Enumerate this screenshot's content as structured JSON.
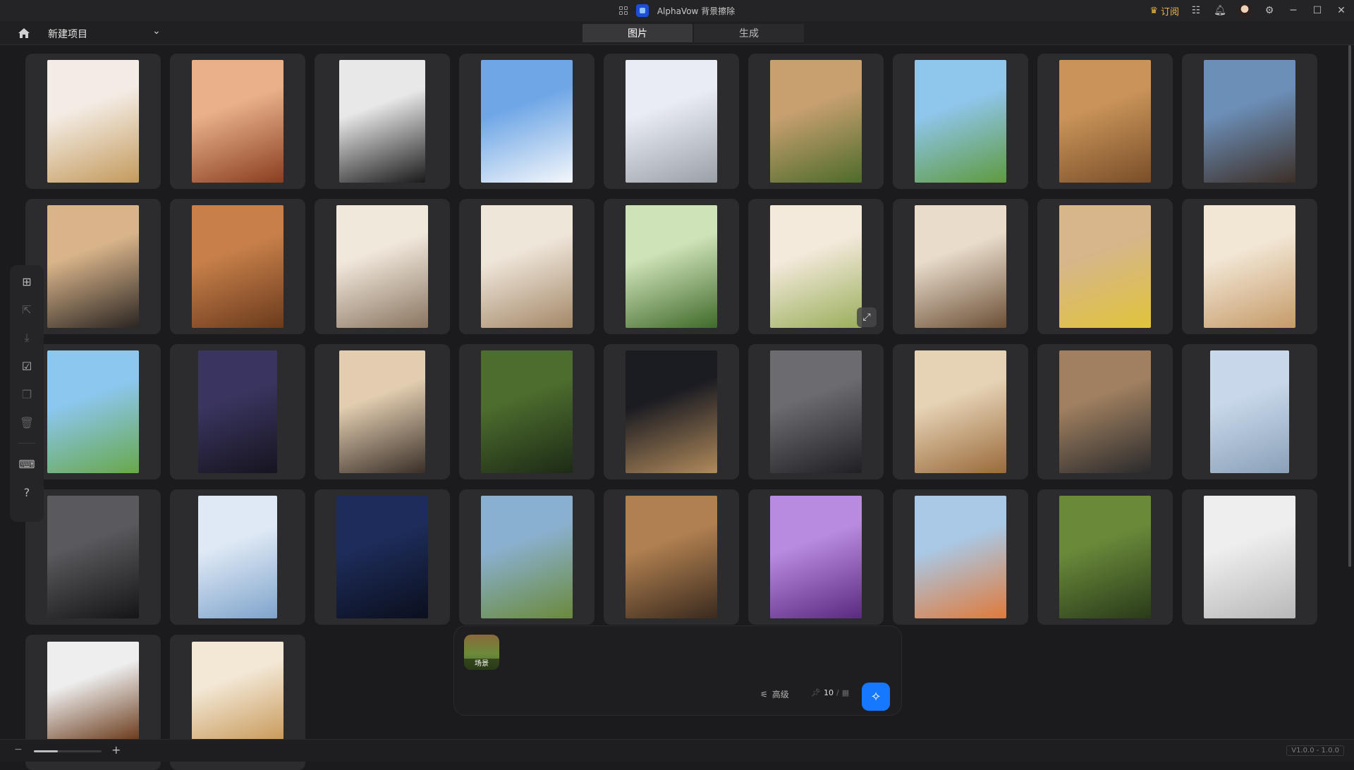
{
  "window": {
    "title": "AlphaVow 背景擦除",
    "subscribe_label": "订阅"
  },
  "toolbar": {
    "project_name": "新建项目"
  },
  "tabs": [
    {
      "label": "图片",
      "active": true
    },
    {
      "label": "生成",
      "active": false
    }
  ],
  "gallery": {
    "items": [
      {
        "name": "perfume-swirl",
        "c1": "#f3ece4",
        "c2": "#c49a5c"
      },
      {
        "name": "perfume-roses",
        "c1": "#e8b18a",
        "c2": "#8a3d20"
      },
      {
        "name": "serum-black-white",
        "c1": "#e8e8e8",
        "c2": "#1a1a1a"
      },
      {
        "name": "cream-jar-blue",
        "c1": "#6fa7e6",
        "c2": "#f4f7fb"
      },
      {
        "name": "perfume-silver",
        "c1": "#e9edf3",
        "c2": "#9aa0a8"
      },
      {
        "name": "speaker-tent",
        "c1": "#c8a070",
        "c2": "#4d6b2a"
      },
      {
        "name": "phone-meadow",
        "c1": "#8fc6ec",
        "c2": "#5f9a3e"
      },
      {
        "name": "phone-desert",
        "c1": "#c9945a",
        "c2": "#7a4e28"
      },
      {
        "name": "smartwatch-rock",
        "c1": "#6c8fb8",
        "c2": "#3d2f27"
      },
      {
        "name": "camera-table",
        "c1": "#d9b48a",
        "c2": "#2a2522"
      },
      {
        "name": "phone-armchair",
        "c1": "#c8804a",
        "c2": "#6a3a1c"
      },
      {
        "name": "fan-room",
        "c1": "#f1e8dc",
        "c2": "#8a7560"
      },
      {
        "name": "purifier-livingroom",
        "c1": "#efe6da",
        "c2": "#a48868"
      },
      {
        "name": "bottles-green",
        "c1": "#cfe3b8",
        "c2": "#3f6a2a"
      },
      {
        "name": "drinks-cucumber",
        "c1": "#f4eadc",
        "c2": "#9aae5a"
      },
      {
        "name": "fan-interior",
        "c1": "#e9dccb",
        "c2": "#6b4f36"
      },
      {
        "name": "mixer-kitchen",
        "c1": "#d6b68a",
        "c2": "#e0c43a"
      },
      {
        "name": "salad-bowl",
        "c1": "#f2e6d4",
        "c2": "#c59a68"
      },
      {
        "name": "milk-can-field",
        "c1": "#8cc7f0",
        "c2": "#67a84a"
      },
      {
        "name": "cream-purple",
        "c1": "#3a3560",
        "c2": "#16141f"
      },
      {
        "name": "oven-kitchen",
        "c1": "#e2cdb0",
        "c2": "#3a2f28"
      },
      {
        "name": "projector-forest",
        "c1": "#4d6d2e",
        "c2": "#1d2a16"
      },
      {
        "name": "toothbrush-dark",
        "c1": "#1b1b22",
        "c2": "#b08a5a"
      },
      {
        "name": "range-hood",
        "c1": "#6b6b70",
        "c2": "#202024"
      },
      {
        "name": "kitchen-blender",
        "c1": "#e6d3b6",
        "c2": "#9a6a3a"
      },
      {
        "name": "stove-dark",
        "c1": "#a08060",
        "c2": "#2a2a2c"
      },
      {
        "name": "phone-ring-light",
        "c1": "#c8d8ea",
        "c2": "#8aa0b8"
      },
      {
        "name": "speaker-stage",
        "c1": "#5a5a5e",
        "c2": "#151517"
      },
      {
        "name": "toothpaste-water",
        "c1": "#dfe9f5",
        "c2": "#7fa4cc"
      },
      {
        "name": "serum-night",
        "c1": "#1d2c5a",
        "c2": "#0b0f1d"
      },
      {
        "name": "projector-camping",
        "c1": "#8ab0cf",
        "c2": "#6a8a3a"
      },
      {
        "name": "phone-desk",
        "c1": "#b08050",
        "c2": "#3a2a1e"
      },
      {
        "name": "serum-flowers",
        "c1": "#b88ae0",
        "c2": "#5a2a80"
      },
      {
        "name": "phone-ice",
        "c1": "#a9c9e6",
        "c2": "#e07a3a"
      },
      {
        "name": "headphones-forest",
        "c1": "#6a8a3a",
        "c2": "#2a3a1a"
      },
      {
        "name": "serum-green-water",
        "c1": "#eeeeee",
        "c2": "#b8b8b8"
      },
      {
        "name": "serum-amber-glass",
        "c1": "#eeeeee",
        "c2": "#6a3a1a"
      },
      {
        "name": "cream-gold",
        "c1": "#f3e8d6",
        "c2": "#c89a5a"
      }
    ]
  },
  "composer": {
    "reference_label": "场景",
    "advanced_label": "高级",
    "count_value": "10",
    "count_separator": "/"
  },
  "status": {
    "version": "V1.0.0 - 1.0.0",
    "zoom_level": 0.35
  },
  "colors": {
    "accent": "#1677ff",
    "subscribe": "#f0b34a",
    "background": "#1b1b1d"
  }
}
